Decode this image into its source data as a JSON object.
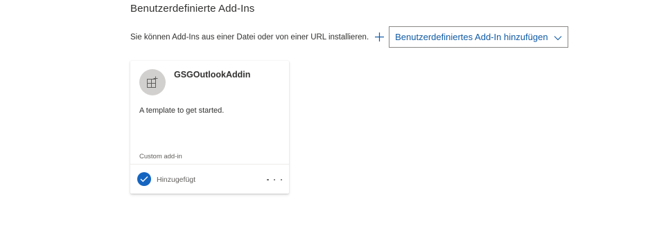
{
  "section": {
    "title": "Benutzerdefinierte Add-Ins"
  },
  "install": {
    "description": "Sie können Add-Ins aus einer Datei oder von einer URL installieren.",
    "add_button_label": "Benutzerdefiniertes Add-In hinzufügen",
    "add_icon": "plus-icon",
    "dropdown_icon": "chevron-down-icon"
  },
  "addin_card": {
    "icon": "addin-icon",
    "title": "GSGOutlookAddin",
    "description": "A template to get started.",
    "type": "Custom add-in",
    "status_icon": "checkmark-icon",
    "status": "Hinzugefügt",
    "more_icon": "more-icon"
  },
  "colors": {
    "accent": "#0f5aa6",
    "status": "#1565c0"
  }
}
